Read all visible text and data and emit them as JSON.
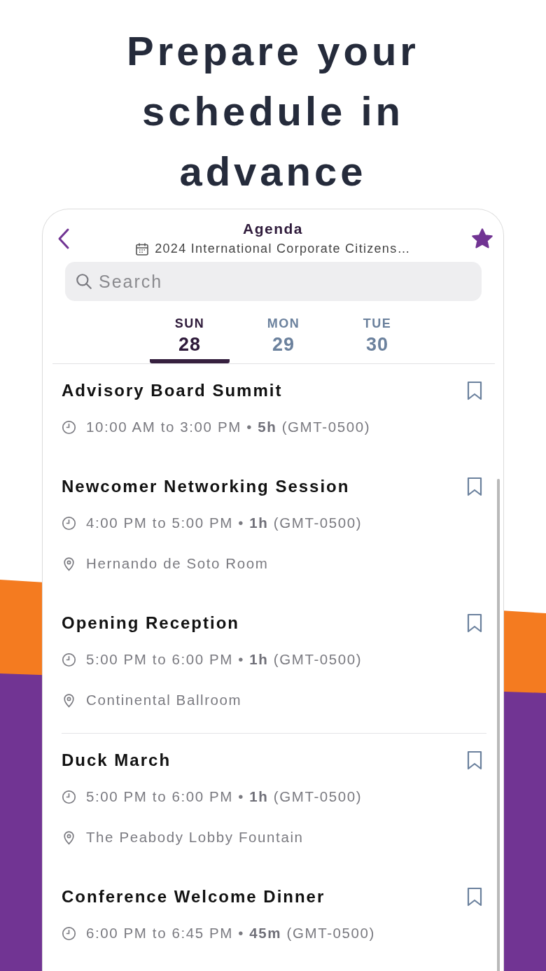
{
  "headline": "Prepare your schedule in advance",
  "header": {
    "title": "Agenda",
    "subtitle": "2024 International Corporate Citizens…",
    "favorite": true
  },
  "search": {
    "placeholder": "Search"
  },
  "days": [
    {
      "weekday": "SUN",
      "date": "28",
      "selected": true
    },
    {
      "weekday": "MON",
      "date": "29",
      "selected": false
    },
    {
      "weekday": "TUE",
      "date": "30",
      "selected": false
    }
  ],
  "events": [
    {
      "title": "Advisory Board Summit",
      "time": "10:00 AM to 3:00 PM • **5h** (GMT-0500)",
      "bookmarked": false,
      "divider_below": false
    },
    {
      "title": "Newcomer Networking Session",
      "time": "4:00 PM to 5:00 PM • **1h** (GMT-0500)",
      "location": "Hernando de Soto Room",
      "bookmarked": false,
      "divider_below": false
    },
    {
      "title": "Opening Reception",
      "time": "5:00 PM to 6:00 PM • **1h** (GMT-0500)",
      "location": "Continental Ballroom",
      "bookmarked": false,
      "divider_below": true
    },
    {
      "title": "Duck March",
      "time": "5:00 PM to 6:00 PM • **1h** (GMT-0500)",
      "location": "The Peabody Lobby Fountain",
      "bookmarked": false,
      "divider_below": false
    },
    {
      "title": "Conference Welcome Dinner",
      "time": "6:00 PM to 6:45 PM • **45m** (GMT-0500)",
      "bookmarked": false,
      "divider_below": false
    }
  ]
}
